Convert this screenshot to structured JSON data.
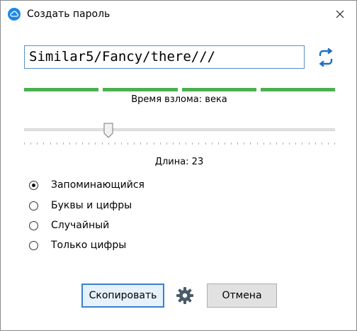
{
  "window": {
    "title": "Создать пароль",
    "icon": "cloud-icon",
    "accent": "#1e88e5"
  },
  "password": {
    "value": "Similar5/Fancy/there///"
  },
  "strength": {
    "segments_filled": 4,
    "segments_total": 4,
    "color": "#4caf50",
    "crack_time_label": "Время взлома: века"
  },
  "length": {
    "value": 23,
    "label": "Длина: 23",
    "slider_fraction": 0.27
  },
  "modes": [
    {
      "label": "Запоминающийся",
      "checked": true
    },
    {
      "label": "Буквы и цифры",
      "checked": false
    },
    {
      "label": "Случайный",
      "checked": false
    },
    {
      "label": "Только цифры",
      "checked": false
    }
  ],
  "buttons": {
    "copy_label": "Скопировать",
    "cancel_label": "Отмена",
    "settings_icon": "gear-icon"
  }
}
